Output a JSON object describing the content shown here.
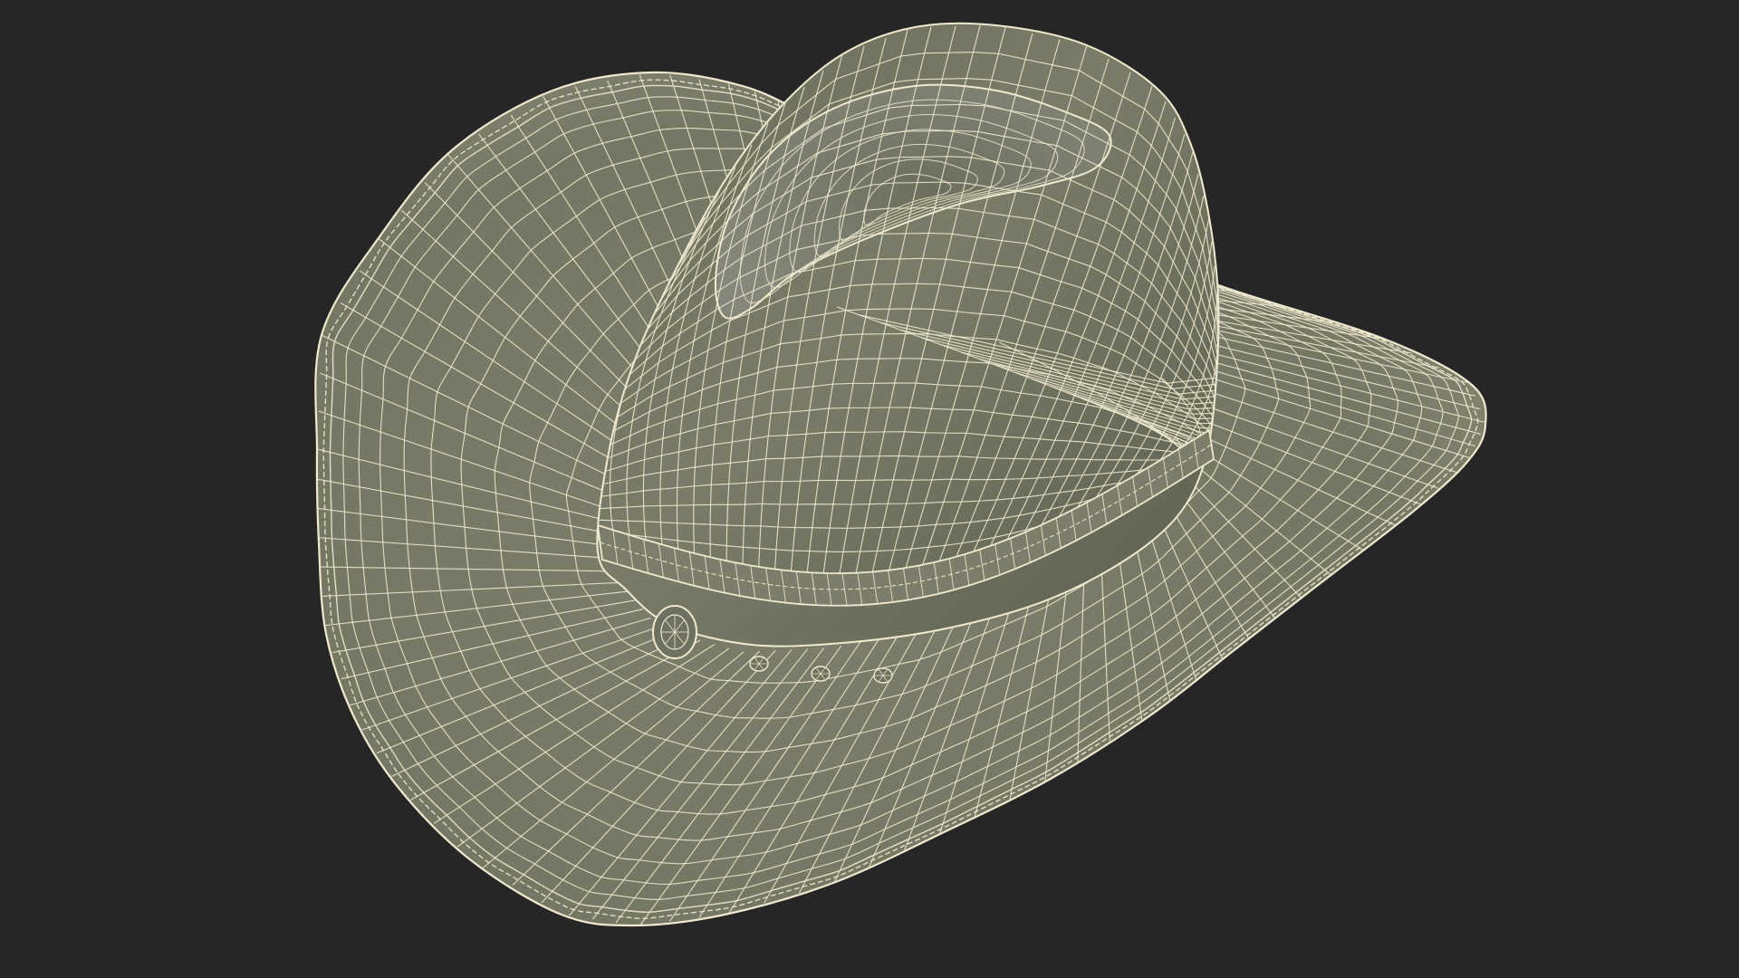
{
  "scene": {
    "subject": "cowboy-hat-wireframe",
    "background_color": "#262626",
    "surface_color": "#787a68",
    "surface_shadow_color": "#5b5d4e",
    "surface_highlight_color": "#8c8e7b",
    "wire_color": "#efe9cf",
    "view": "perspective",
    "shading": "smooth-with-wireframe-overlay"
  }
}
